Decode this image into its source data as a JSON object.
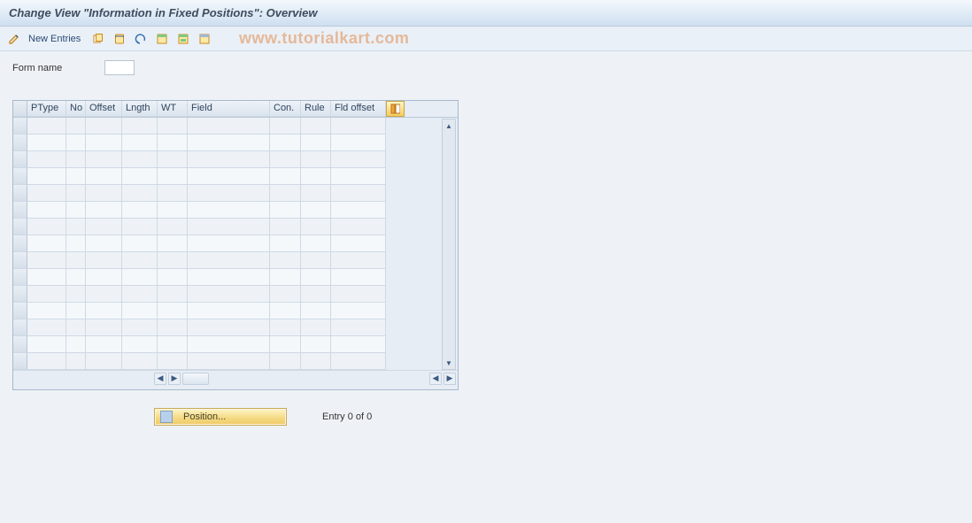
{
  "header": {
    "title": "Change View \"Information in Fixed Positions\": Overview"
  },
  "toolbar": {
    "new_entries_label": "New Entries"
  },
  "watermark": "www.tutorialkart.com",
  "form": {
    "name_label": "Form name",
    "name_value": ""
  },
  "grid": {
    "columns": {
      "ptype": "PType",
      "no": "No",
      "offset": "Offset",
      "lngth": "Lngth",
      "wt": "WT",
      "field": "Field",
      "con": "Con.",
      "rule": "Rule",
      "fld_offset": "Fld offset"
    },
    "row_count": 15
  },
  "footer": {
    "position_label": "Position...",
    "entry_text": "Entry 0 of 0"
  }
}
